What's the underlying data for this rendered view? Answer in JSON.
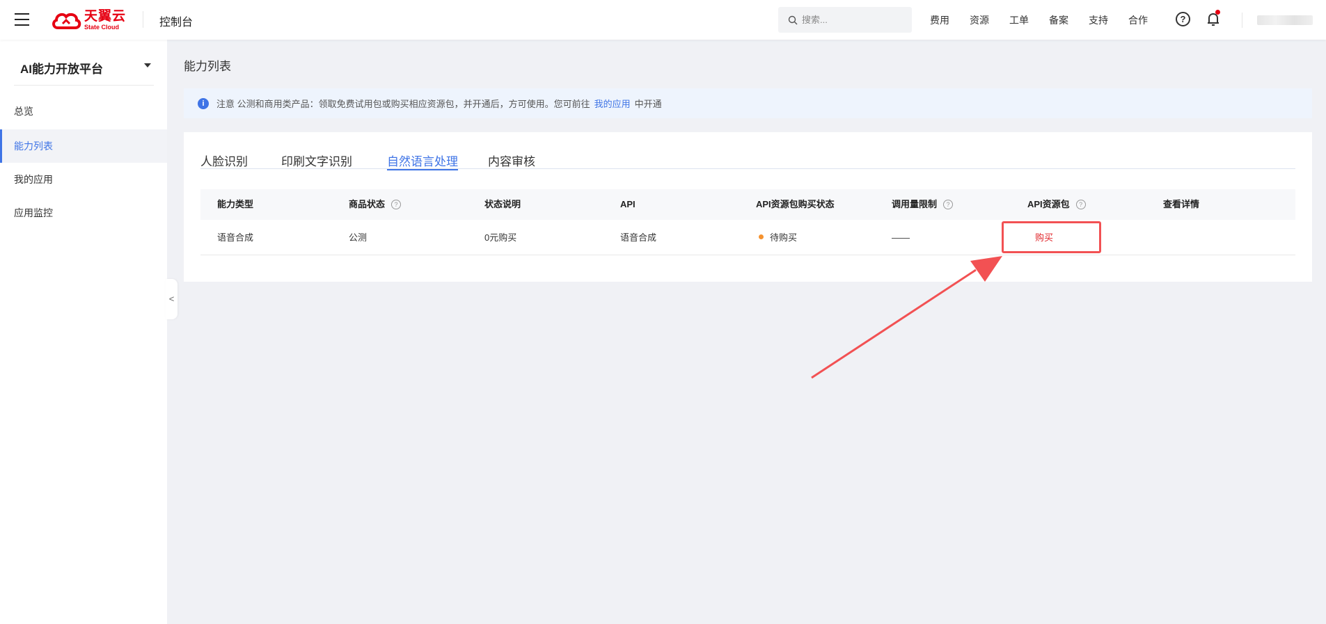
{
  "topbar": {
    "logo_cn": "天翼云",
    "logo_en": "State Cloud",
    "console_title": "控制台",
    "search_placeholder": "搜索...",
    "nav": [
      "费用",
      "资源",
      "工单",
      "备案",
      "支持",
      "合作"
    ],
    "help_glyph": "?"
  },
  "sidebar": {
    "title": "AI能力开放平台",
    "items": [
      {
        "label": "总览",
        "active": false
      },
      {
        "label": "能力列表",
        "active": true
      },
      {
        "label": "我的应用",
        "active": false
      },
      {
        "label": "应用监控",
        "active": false
      }
    ],
    "collapse_glyph": "<"
  },
  "main": {
    "page_title": "能力列表",
    "notice": {
      "icon_glyph": "i",
      "text_before": "注意 公测和商用类产品：领取免费试用包或购买相应资源包，并开通后，方可使用。您可前往",
      "link": "我的应用",
      "text_after": "中开通"
    },
    "tabs": [
      "人脸识别",
      "印刷文字识别",
      "自然语言处理",
      "内容审核"
    ],
    "active_tab": "自然语言处理",
    "table": {
      "headers": [
        "能力类型",
        "商品状态",
        "状态说明",
        "API",
        "API资源包购买状态",
        "调用量限制",
        "API资源包",
        "查看详情"
      ],
      "rows": [
        {
          "type": "语音合成",
          "status": "公测",
          "desc": "0元购买",
          "api": "语音合成",
          "purchase_status": "待购买",
          "limit": "——",
          "package_action": "购买",
          "detail": ""
        }
      ]
    }
  },
  "colors": {
    "accent": "#3f74e6",
    "brand": "#e60012",
    "annotation": "#f25153",
    "pending_dot": "#f5922f"
  }
}
